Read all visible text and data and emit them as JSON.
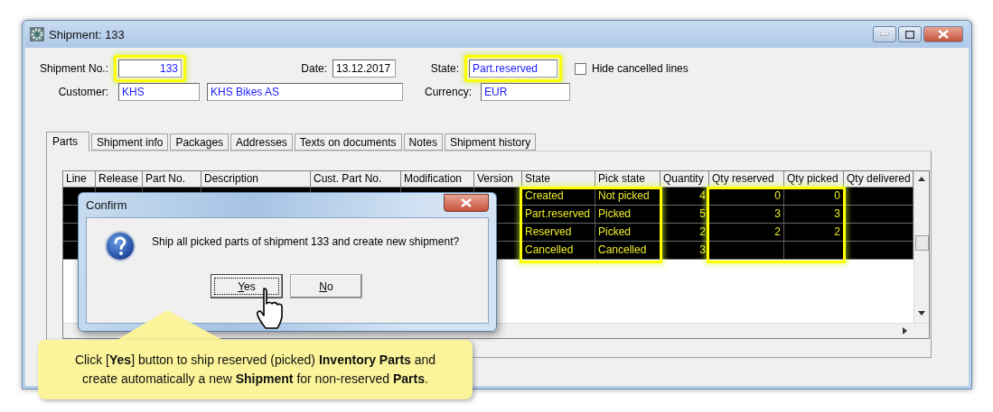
{
  "window": {
    "title": "Shipment: 133"
  },
  "form": {
    "shipment_no": {
      "label": "Shipment No.:",
      "value": "133",
      "highlighted": true
    },
    "date": {
      "label": "Date:",
      "value": "13.12.2017"
    },
    "state": {
      "label": "State:",
      "value": "Part.reserved",
      "highlighted": true
    },
    "hide_cancelled": {
      "label": "Hide cancelled lines",
      "checked": false
    },
    "customer": {
      "label": "Customer:",
      "code": "KHS",
      "name": "KHS Bikes AS"
    },
    "currency": {
      "label": "Currency:",
      "value": "EUR"
    }
  },
  "tabs": [
    {
      "label": "Parts",
      "selected": true
    },
    {
      "label": "Shipment info",
      "selected": false
    },
    {
      "label": "Packages",
      "selected": false
    },
    {
      "label": "Addresses",
      "selected": false
    },
    {
      "label": "Texts on documents",
      "selected": false
    },
    {
      "label": "Notes",
      "selected": false
    },
    {
      "label": "Shipment history",
      "selected": false
    }
  ],
  "table": {
    "columns": [
      {
        "label": "Line",
        "highlighted": false
      },
      {
        "label": "Release",
        "highlighted": false
      },
      {
        "label": "Part No.",
        "highlighted": false
      },
      {
        "label": "Description",
        "highlighted": false
      },
      {
        "label": "Cust. Part No.",
        "highlighted": false
      },
      {
        "label": "Modification",
        "highlighted": false
      },
      {
        "label": "Version",
        "highlighted": false
      },
      {
        "label": "State",
        "highlighted": true
      },
      {
        "label": "Pick state",
        "highlighted": true
      },
      {
        "label": "Quantity",
        "highlighted": false
      },
      {
        "label": "Qty reserved",
        "highlighted": true
      },
      {
        "label": "Qty picked",
        "highlighted": true
      },
      {
        "label": "Qty delivered",
        "highlighted": false
      }
    ],
    "rows": [
      {
        "cells": [
          null,
          null,
          null,
          null,
          null,
          null,
          null,
          "Created",
          "Not picked",
          "4",
          "0",
          "0",
          null
        ]
      },
      {
        "cells": [
          null,
          null,
          null,
          null,
          null,
          null,
          null,
          "Part.reserved",
          "Picked",
          "5",
          "3",
          "3",
          null
        ]
      },
      {
        "cells": [
          null,
          null,
          null,
          null,
          null,
          null,
          null,
          "Reserved",
          "Picked",
          "2",
          "2",
          "2",
          null
        ]
      },
      {
        "cells": [
          null,
          null,
          null,
          null,
          null,
          null,
          null,
          "Cancelled",
          "Cancelled",
          "3",
          null,
          null,
          null
        ]
      }
    ]
  },
  "dialog": {
    "title": "Confirm",
    "message": "Ship all picked parts of shipment 133 and create new shipment?",
    "buttons": [
      {
        "label": "Yes",
        "focused": true
      },
      {
        "label": "No",
        "focused": false
      }
    ]
  },
  "callout": {
    "text": "Click [**Yes**] button to ship reserved (picked) **Inventory Parts** and\ncreate automatically a new **Shipment** for non-reserved **Parts**."
  }
}
